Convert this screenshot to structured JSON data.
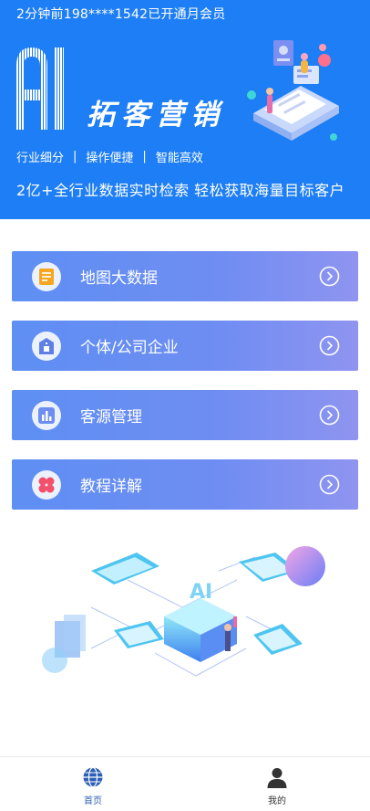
{
  "header": {
    "ticker": "2分钟前198****1542已开通月会员",
    "brand_title": "拓客营销",
    "logo_text": "AI",
    "features": [
      "行业细分",
      "操作便捷",
      "智能高效"
    ],
    "feature_separator": "|",
    "slogan": "2亿+全行业数据实时检索  轻松获取海量目标客户"
  },
  "menu": [
    {
      "label": "地图大数据",
      "icon": "map-data-icon"
    },
    {
      "label": "个体/公司企业",
      "icon": "company-icon"
    },
    {
      "label": "客源管理",
      "icon": "chart-icon"
    },
    {
      "label": "教程详解",
      "icon": "grid-icon"
    }
  ],
  "tabbar": {
    "home_label": "首页",
    "mine_label": "我的"
  },
  "colors": {
    "hero_bg": "#1e7ef5",
    "card_start": "#5e8ff3",
    "card_end": "#8f94f0",
    "tab_active": "#2c5fb5"
  }
}
